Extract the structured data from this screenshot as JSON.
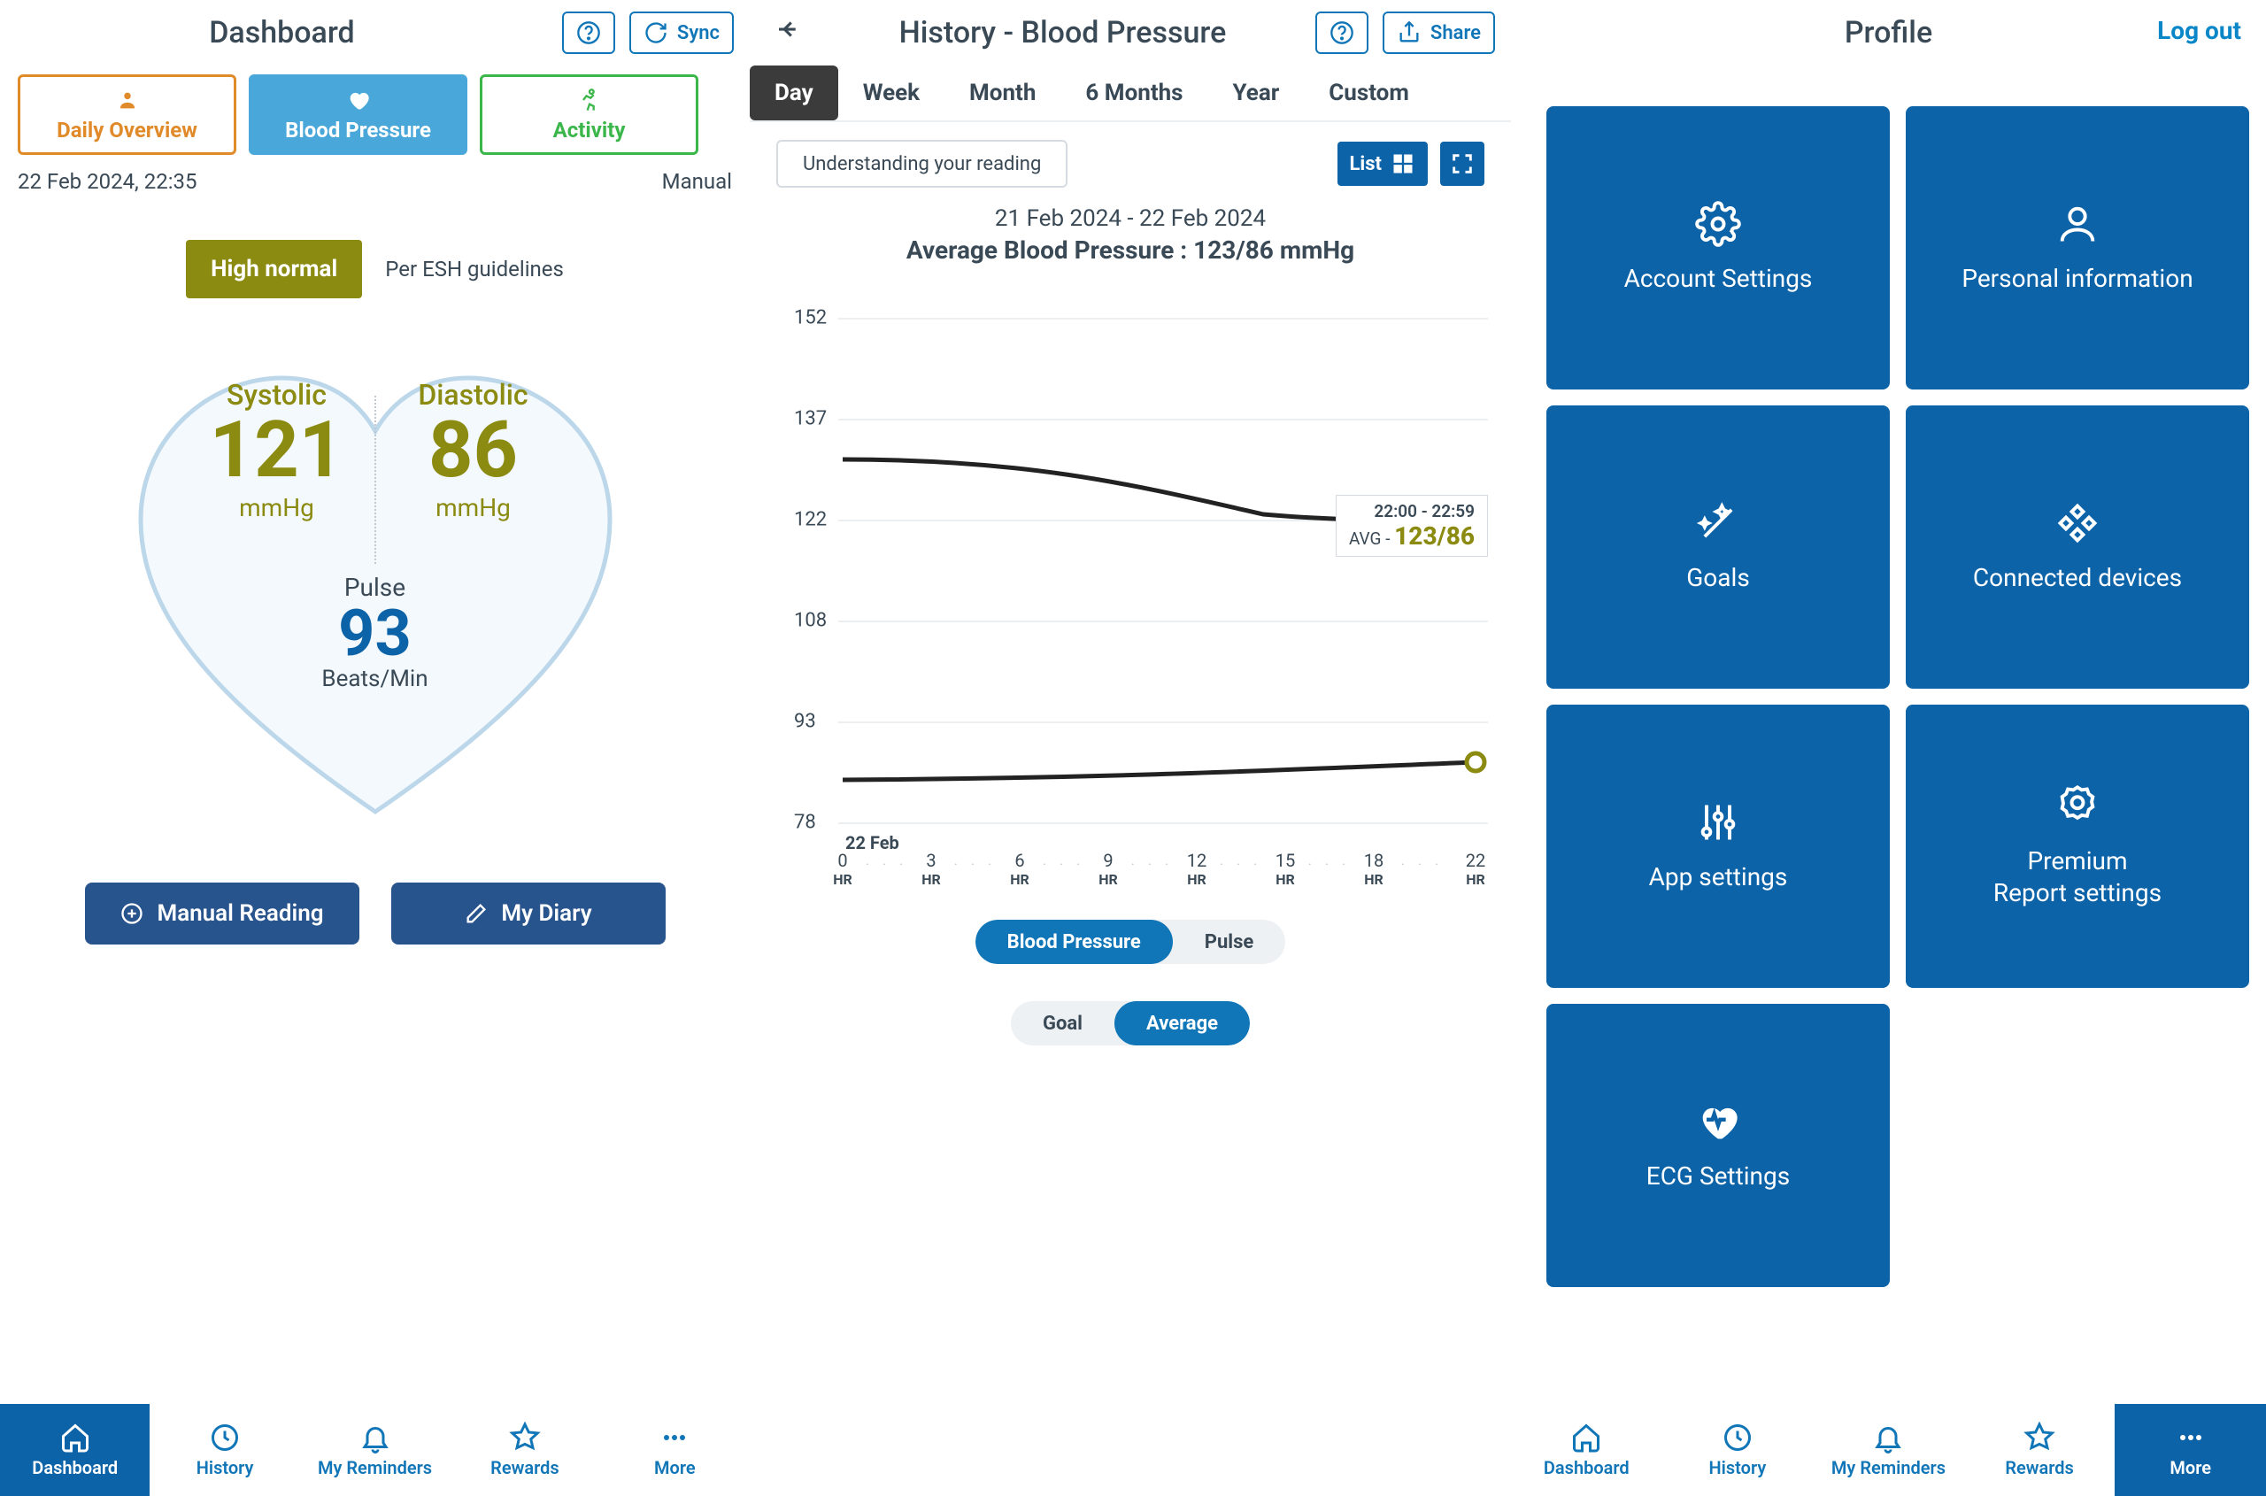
{
  "dashboard": {
    "title": "Dashboard",
    "sync_label": "Sync",
    "tabs": {
      "overview": "Daily Overview",
      "bp": "Blood Pressure",
      "activity": "Activity"
    },
    "timestamp": "22 Feb 2024, 22:35",
    "mode": "Manual",
    "status_badge": "High normal",
    "status_note": "Per ESH guidelines",
    "systolic_label": "Systolic",
    "systolic_value": "121",
    "diastolic_label": "Diastolic",
    "diastolic_value": "86",
    "unit": "mmHg",
    "pulse_label": "Pulse",
    "pulse_value": "93",
    "pulse_unit": "Beats/Min",
    "btn_manual": "Manual Reading",
    "btn_diary": "My Diary"
  },
  "history": {
    "title": "History - Blood Pressure",
    "share_label": "Share",
    "ranges": [
      "Day",
      "Week",
      "Month",
      "6 Months",
      "Year",
      "Custom"
    ],
    "active_range": "Day",
    "understand": "Understanding your reading",
    "list_label": "List",
    "date_range": "21 Feb 2024 - 22 Feb 2024",
    "avg_line": "Average Blood Pressure : 123/86 mmHg",
    "tooltip_time": "22:00 - 22:59",
    "tooltip_prefix": "AVG - ",
    "tooltip_value": "123/86",
    "x_date": "22 Feb",
    "seg1": {
      "a": "Blood Pressure",
      "b": "Pulse"
    },
    "seg2": {
      "a": "Goal",
      "b": "Average"
    }
  },
  "profile": {
    "title": "Profile",
    "logout": "Log out",
    "tiles": [
      "Account Settings",
      "Personal information",
      "Goals",
      "Connected devices",
      "App settings",
      "Premium\nReport settings",
      "ECG Settings"
    ]
  },
  "nav": {
    "dashboard": "Dashboard",
    "history": "History",
    "reminders": "My Reminders",
    "rewards": "Rewards",
    "more": "More"
  },
  "chart_data": {
    "type": "line",
    "title": "Average Blood Pressure : 123/86 mmHg",
    "subtitle": "21 Feb 2024 - 22 Feb 2024",
    "xlabel": "Hour",
    "ylabel": "mmHg",
    "ylim": [
      78,
      152
    ],
    "yticks": [
      78,
      93,
      108,
      122,
      137,
      152
    ],
    "x": [
      0,
      3,
      6,
      9,
      12,
      15,
      18,
      22
    ],
    "x_display": [
      "0 HR",
      "3 HR",
      "6 HR",
      "9 HR",
      "12 HR",
      "15 HR",
      "18 HR",
      "22 HR"
    ],
    "series": [
      {
        "name": "Systolic",
        "values": [
          131,
          131,
          130,
          128,
          125,
          123,
          123,
          123
        ]
      },
      {
        "name": "Diastolic",
        "values": [
          84,
          84,
          84,
          85,
          85,
          86,
          86,
          86
        ]
      }
    ],
    "highlight": {
      "x": 22,
      "label": "22:00 - 22:59",
      "text": "AVG - 123/86"
    }
  }
}
